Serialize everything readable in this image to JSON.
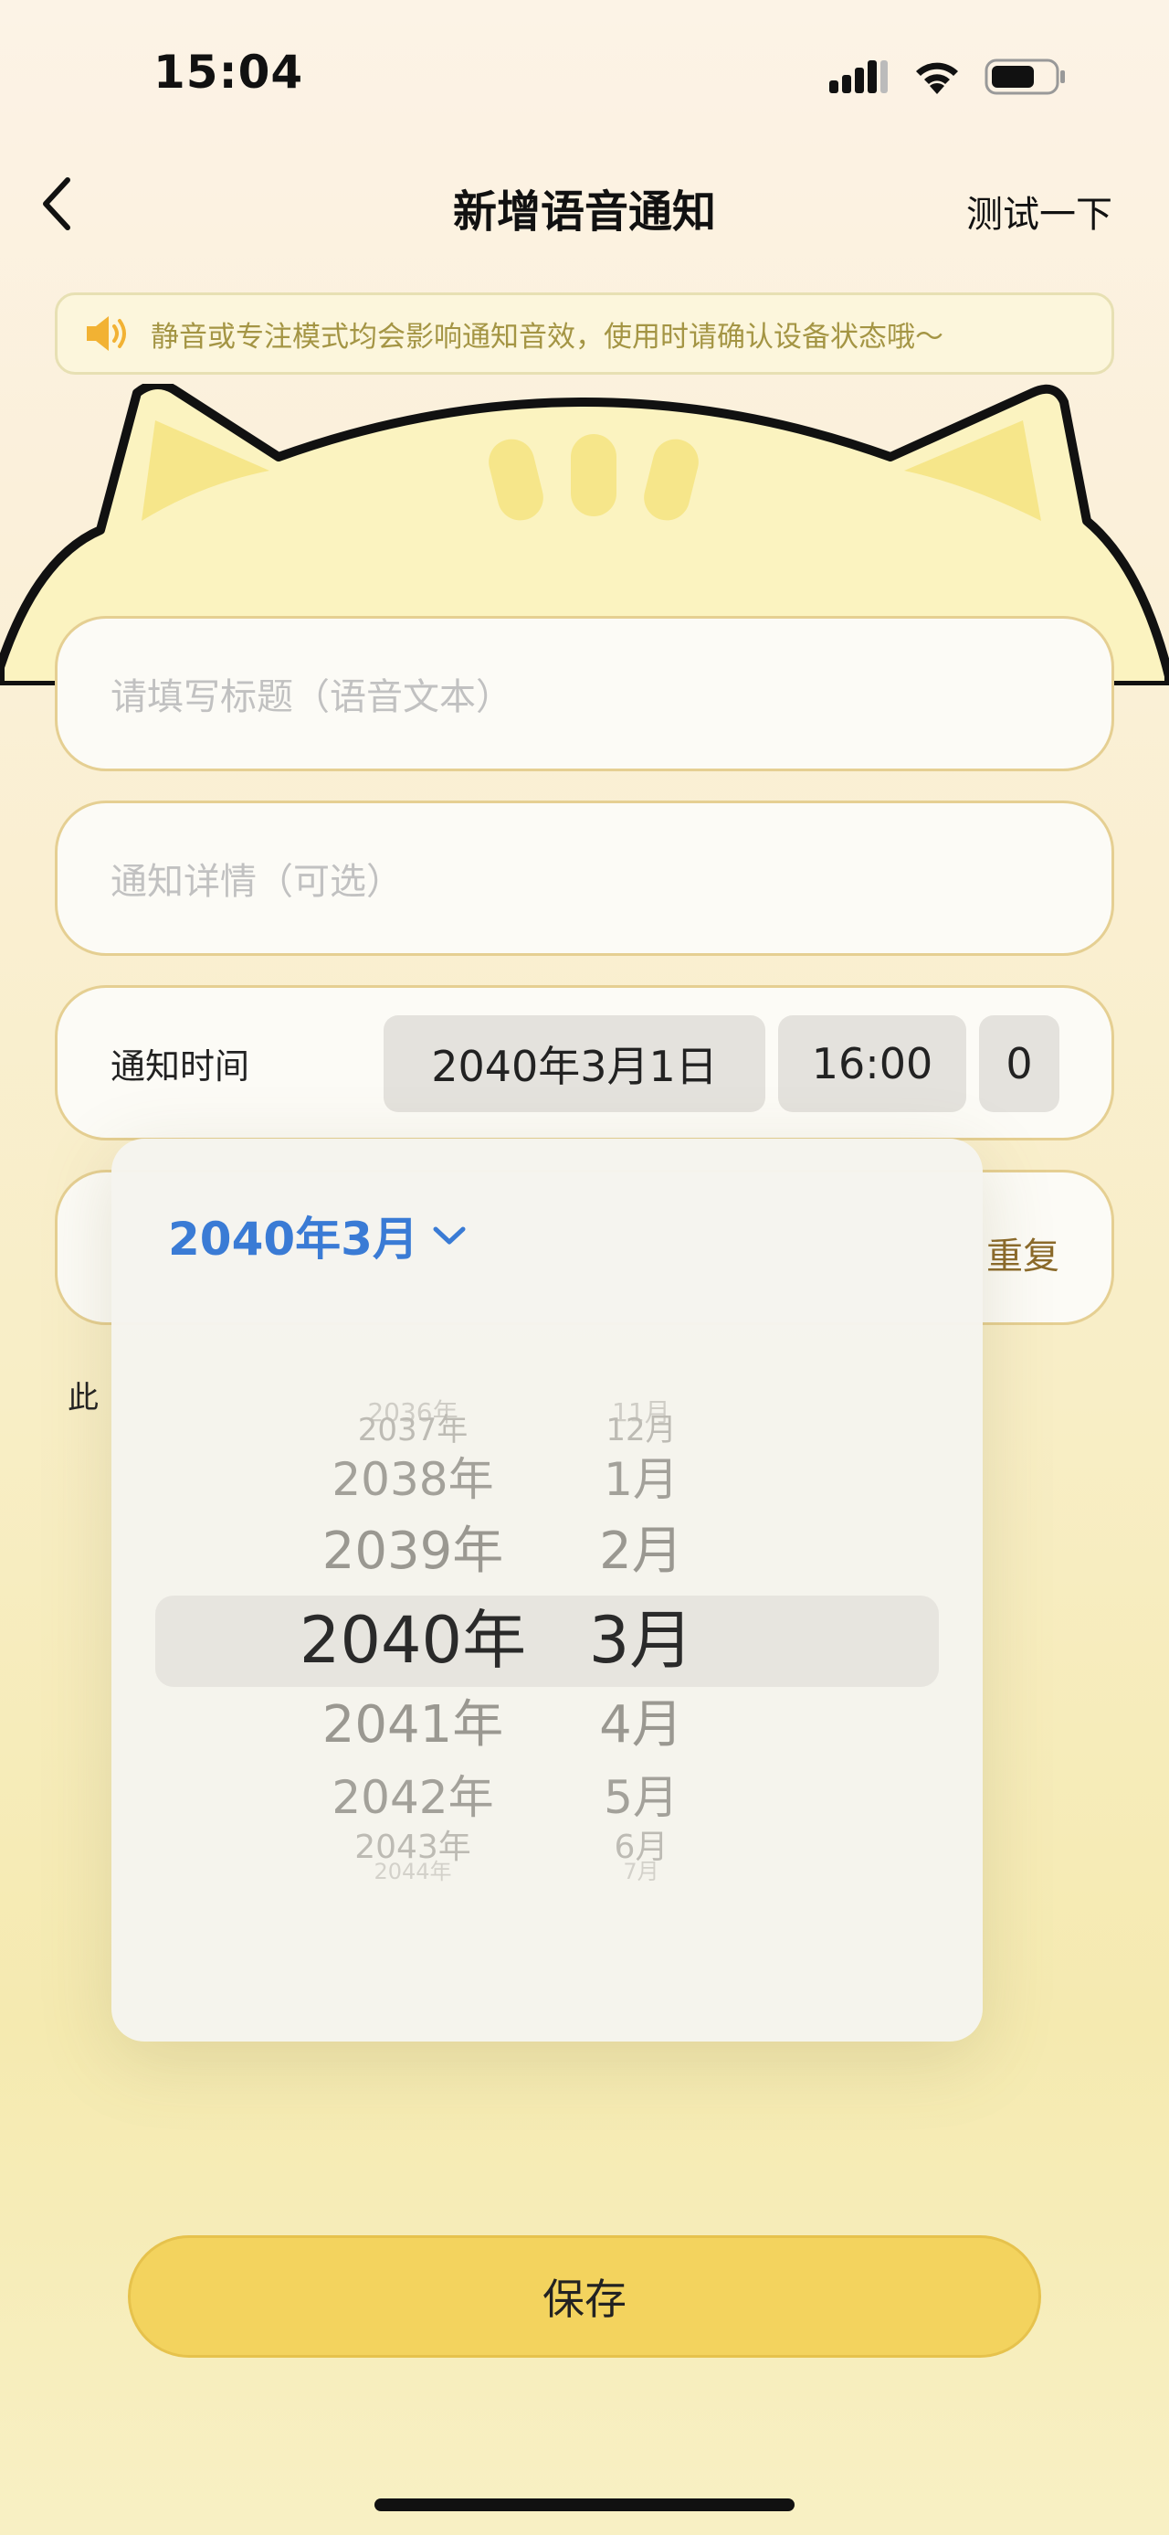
{
  "status_bar": {
    "time": "15:04",
    "icons": [
      "signal-icon",
      "wifi-icon",
      "battery-icon"
    ]
  },
  "nav": {
    "back_icon": "chevron-left-icon",
    "title": "新增语音通知",
    "test_label": "测试一下"
  },
  "notice": {
    "icon": "speaker-icon",
    "text": "静音或专注模式均会影响通知音效，使用时请确认设备状态哦～"
  },
  "form": {
    "title_placeholder": "请填写标题（语音文本）",
    "detail_placeholder": "通知详情（可选）",
    "time_label": "通知时间",
    "date_value": "2040年3月1日",
    "time_value": "16:00",
    "extra_value": "0",
    "repeat_label": "重复",
    "hint_fragment": "此"
  },
  "picker": {
    "header": "2040年3月",
    "header_icon": "chevron-down-icon",
    "years": [
      "2036年",
      "2037年",
      "2038年",
      "2039年",
      "2040年",
      "2041年",
      "2042年",
      "2043年",
      "2044年"
    ],
    "months": [
      "11月",
      "12月",
      "1月",
      "2月",
      "3月",
      "4月",
      "5月",
      "6月",
      "7月"
    ],
    "selected_year": "2040年",
    "selected_month": "3月"
  },
  "actions": {
    "save_label": "保存"
  },
  "colors": {
    "accent_blue": "#3a7bd5",
    "save_yellow": "#f3d35e",
    "card_border": "#e5cf92",
    "cat_fill": "#fbf3c0"
  }
}
